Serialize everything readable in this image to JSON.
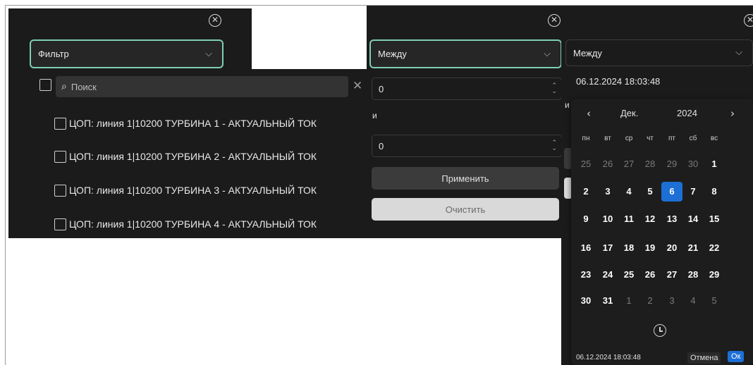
{
  "filter_panel": {
    "select_label": "Фильтр",
    "search_placeholder": "Поиск",
    "items": [
      {
        "label": "ЦОП: линия 1|10200 ТУРБИНА 1 - АКТУАЛЬНЫЙ ТОК"
      },
      {
        "label": "ЦОП: линия 1|10200 ТУРБИНА 2 - АКТУАЛЬНЫЙ ТОК"
      },
      {
        "label": "ЦОП: линия 1|10200 ТУРБИНА 3 - АКТУАЛЬНЫЙ ТОК"
      },
      {
        "label": "ЦОП: линия 1|10200 ТУРБИНА 4 - АКТУАЛЬНЫЙ ТОК"
      }
    ]
  },
  "number_panel": {
    "select_label": "Между",
    "from_value": "0",
    "and_label": "и",
    "to_value": "0",
    "apply_label": "Применить",
    "clear_label": "Очистить"
  },
  "date_panel": {
    "select_label": "Между",
    "value": "06.12.2024 18:03:48",
    "and_label": "и",
    "calendar": {
      "month": "Дек.",
      "year": "2024",
      "weekdays": [
        "пн",
        "вт",
        "ср",
        "чт",
        "пт",
        "сб",
        "вс"
      ],
      "weeks": [
        [
          "25",
          "26",
          "27",
          "28",
          "29",
          "30",
          "1"
        ],
        [
          "2",
          "3",
          "4",
          "5",
          "6",
          "7",
          "8"
        ],
        [
          "9",
          "10",
          "11",
          "12",
          "13",
          "14",
          "15"
        ],
        [
          "16",
          "17",
          "18",
          "19",
          "20",
          "21",
          "22"
        ],
        [
          "23",
          "24",
          "25",
          "26",
          "27",
          "28",
          "29"
        ],
        [
          "30",
          "31",
          "1",
          "2",
          "3",
          "4",
          "5"
        ]
      ],
      "selected_day": "6",
      "footer_value": "06.12.2024 18:03:48",
      "cancel_label": "Отмена",
      "ok_label": "Ок"
    }
  },
  "icons": {
    "close": "close-circle-icon",
    "chevron": "chevron-down-icon",
    "search": "search-icon",
    "clear": "clear-x-icon",
    "clock": "clock-icon"
  },
  "colors": {
    "panel_bg": "#1b1b1b",
    "focus_border": "#7fcfb0",
    "selected_day": "#1d6fd6"
  }
}
